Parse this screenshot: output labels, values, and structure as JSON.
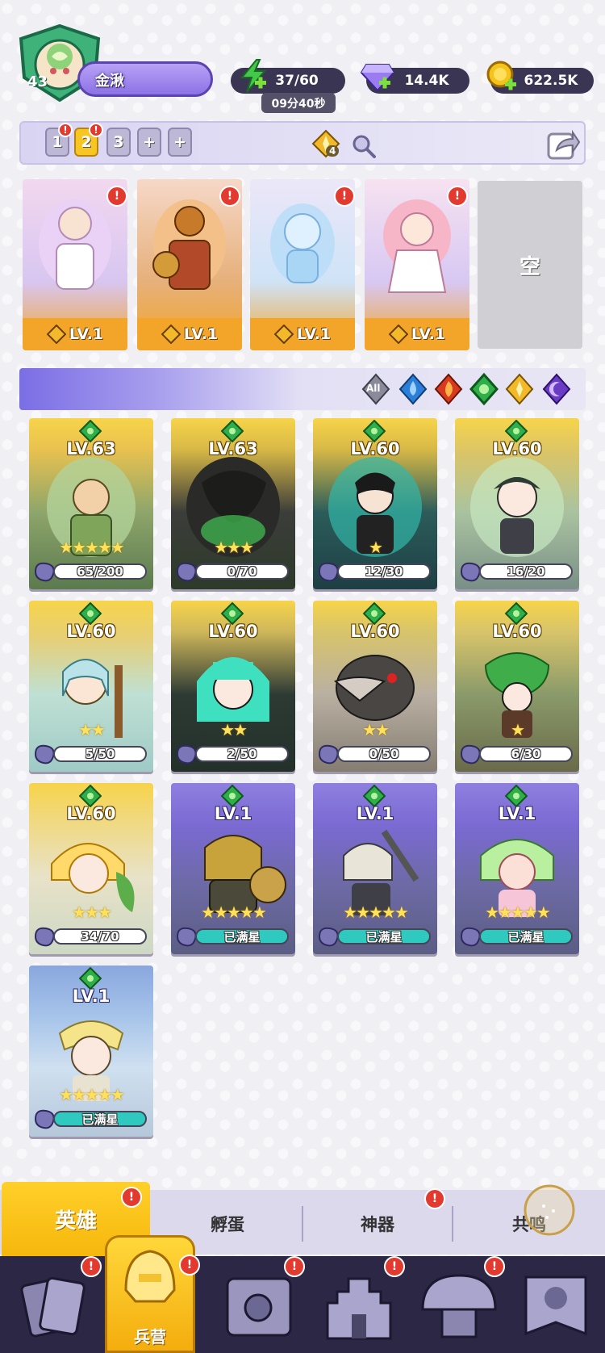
{
  "player": {
    "level": "43",
    "name": "金湫"
  },
  "resources": {
    "stamina": "37/60",
    "stamina_timer": "09分40秒",
    "gems": "14.4K",
    "coins": "622.5K"
  },
  "team_tabs": [
    "1",
    "2",
    "3",
    "+",
    "+"
  ],
  "team_bar": {
    "star_count": "4"
  },
  "formation": [
    {
      "level": "LV.1"
    },
    {
      "level": "LV.1"
    },
    {
      "level": "LV.1"
    },
    {
      "level": "LV.1"
    }
  ],
  "formation_empty": "空",
  "filters": [
    "All",
    "water",
    "fire",
    "wind",
    "light",
    "dark"
  ],
  "heroes": [
    {
      "level": "LV.63",
      "progress": "65/200",
      "stars": "★★★★★"
    },
    {
      "level": "LV.63",
      "progress": "0/70",
      "stars": "★★★"
    },
    {
      "level": "LV.60",
      "progress": "12/30",
      "stars": "★"
    },
    {
      "level": "LV.60",
      "progress": "16/20",
      "stars": ""
    },
    {
      "level": "LV.60",
      "progress": "5/50",
      "stars": "★★"
    },
    {
      "level": "LV.60",
      "progress": "2/50",
      "stars": "★★"
    },
    {
      "level": "LV.60",
      "progress": "0/50",
      "stars": "★★"
    },
    {
      "level": "LV.60",
      "progress": "6/30",
      "stars": "★"
    },
    {
      "level": "LV.60",
      "progress": "34/70",
      "stars": "★★★"
    },
    {
      "level": "LV.1",
      "progress": "已满星",
      "stars": "★★★★★"
    },
    {
      "level": "LV.1",
      "progress": "已满星",
      "stars": "★★★★★"
    },
    {
      "level": "LV.1",
      "progress": "已满星",
      "stars": "★★★★★"
    },
    {
      "level": "LV.1",
      "progress": "已满星",
      "stars": "★★★★★"
    }
  ],
  "subtabs": [
    "英雄",
    "孵蛋",
    "神器",
    "共鸣"
  ],
  "nav": {
    "active_label": "兵营"
  },
  "colors": {
    "accent_gold": "#f6b70c",
    "accent_purple": "#7b6ee5",
    "alert_red": "#e23a2e",
    "nav_dark": "#2b2745"
  }
}
